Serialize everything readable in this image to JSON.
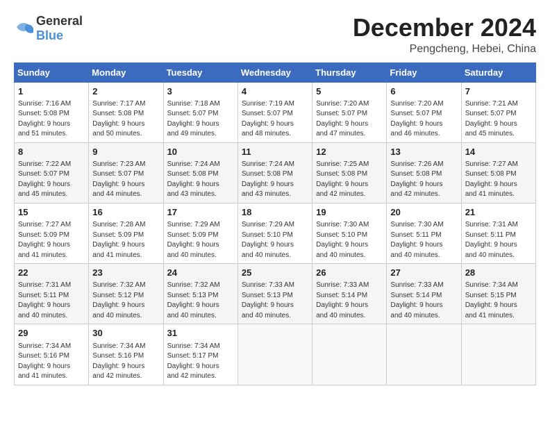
{
  "header": {
    "logo_general": "General",
    "logo_blue": "Blue",
    "month": "December 2024",
    "location": "Pengcheng, Hebei, China"
  },
  "weekdays": [
    "Sunday",
    "Monday",
    "Tuesday",
    "Wednesday",
    "Thursday",
    "Friday",
    "Saturday"
  ],
  "weeks": [
    [
      {
        "day": "1",
        "info": "Sunrise: 7:16 AM\nSunset: 5:08 PM\nDaylight: 9 hours\nand 51 minutes."
      },
      {
        "day": "2",
        "info": "Sunrise: 7:17 AM\nSunset: 5:08 PM\nDaylight: 9 hours\nand 50 minutes."
      },
      {
        "day": "3",
        "info": "Sunrise: 7:18 AM\nSunset: 5:07 PM\nDaylight: 9 hours\nand 49 minutes."
      },
      {
        "day": "4",
        "info": "Sunrise: 7:19 AM\nSunset: 5:07 PM\nDaylight: 9 hours\nand 48 minutes."
      },
      {
        "day": "5",
        "info": "Sunrise: 7:20 AM\nSunset: 5:07 PM\nDaylight: 9 hours\nand 47 minutes."
      },
      {
        "day": "6",
        "info": "Sunrise: 7:20 AM\nSunset: 5:07 PM\nDaylight: 9 hours\nand 46 minutes."
      },
      {
        "day": "7",
        "info": "Sunrise: 7:21 AM\nSunset: 5:07 PM\nDaylight: 9 hours\nand 45 minutes."
      }
    ],
    [
      {
        "day": "8",
        "info": "Sunrise: 7:22 AM\nSunset: 5:07 PM\nDaylight: 9 hours\nand 45 minutes."
      },
      {
        "day": "9",
        "info": "Sunrise: 7:23 AM\nSunset: 5:07 PM\nDaylight: 9 hours\nand 44 minutes."
      },
      {
        "day": "10",
        "info": "Sunrise: 7:24 AM\nSunset: 5:08 PM\nDaylight: 9 hours\nand 43 minutes."
      },
      {
        "day": "11",
        "info": "Sunrise: 7:24 AM\nSunset: 5:08 PM\nDaylight: 9 hours\nand 43 minutes."
      },
      {
        "day": "12",
        "info": "Sunrise: 7:25 AM\nSunset: 5:08 PM\nDaylight: 9 hours\nand 42 minutes."
      },
      {
        "day": "13",
        "info": "Sunrise: 7:26 AM\nSunset: 5:08 PM\nDaylight: 9 hours\nand 42 minutes."
      },
      {
        "day": "14",
        "info": "Sunrise: 7:27 AM\nSunset: 5:08 PM\nDaylight: 9 hours\nand 41 minutes."
      }
    ],
    [
      {
        "day": "15",
        "info": "Sunrise: 7:27 AM\nSunset: 5:09 PM\nDaylight: 9 hours\nand 41 minutes."
      },
      {
        "day": "16",
        "info": "Sunrise: 7:28 AM\nSunset: 5:09 PM\nDaylight: 9 hours\nand 41 minutes."
      },
      {
        "day": "17",
        "info": "Sunrise: 7:29 AM\nSunset: 5:09 PM\nDaylight: 9 hours\nand 40 minutes."
      },
      {
        "day": "18",
        "info": "Sunrise: 7:29 AM\nSunset: 5:10 PM\nDaylight: 9 hours\nand 40 minutes."
      },
      {
        "day": "19",
        "info": "Sunrise: 7:30 AM\nSunset: 5:10 PM\nDaylight: 9 hours\nand 40 minutes."
      },
      {
        "day": "20",
        "info": "Sunrise: 7:30 AM\nSunset: 5:11 PM\nDaylight: 9 hours\nand 40 minutes."
      },
      {
        "day": "21",
        "info": "Sunrise: 7:31 AM\nSunset: 5:11 PM\nDaylight: 9 hours\nand 40 minutes."
      }
    ],
    [
      {
        "day": "22",
        "info": "Sunrise: 7:31 AM\nSunset: 5:11 PM\nDaylight: 9 hours\nand 40 minutes."
      },
      {
        "day": "23",
        "info": "Sunrise: 7:32 AM\nSunset: 5:12 PM\nDaylight: 9 hours\nand 40 minutes."
      },
      {
        "day": "24",
        "info": "Sunrise: 7:32 AM\nSunset: 5:13 PM\nDaylight: 9 hours\nand 40 minutes."
      },
      {
        "day": "25",
        "info": "Sunrise: 7:33 AM\nSunset: 5:13 PM\nDaylight: 9 hours\nand 40 minutes."
      },
      {
        "day": "26",
        "info": "Sunrise: 7:33 AM\nSunset: 5:14 PM\nDaylight: 9 hours\nand 40 minutes."
      },
      {
        "day": "27",
        "info": "Sunrise: 7:33 AM\nSunset: 5:14 PM\nDaylight: 9 hours\nand 40 minutes."
      },
      {
        "day": "28",
        "info": "Sunrise: 7:34 AM\nSunset: 5:15 PM\nDaylight: 9 hours\nand 41 minutes."
      }
    ],
    [
      {
        "day": "29",
        "info": "Sunrise: 7:34 AM\nSunset: 5:16 PM\nDaylight: 9 hours\nand 41 minutes."
      },
      {
        "day": "30",
        "info": "Sunrise: 7:34 AM\nSunset: 5:16 PM\nDaylight: 9 hours\nand 42 minutes."
      },
      {
        "day": "31",
        "info": "Sunrise: 7:34 AM\nSunset: 5:17 PM\nDaylight: 9 hours\nand 42 minutes."
      },
      {
        "day": "",
        "info": ""
      },
      {
        "day": "",
        "info": ""
      },
      {
        "day": "",
        "info": ""
      },
      {
        "day": "",
        "info": ""
      }
    ]
  ]
}
